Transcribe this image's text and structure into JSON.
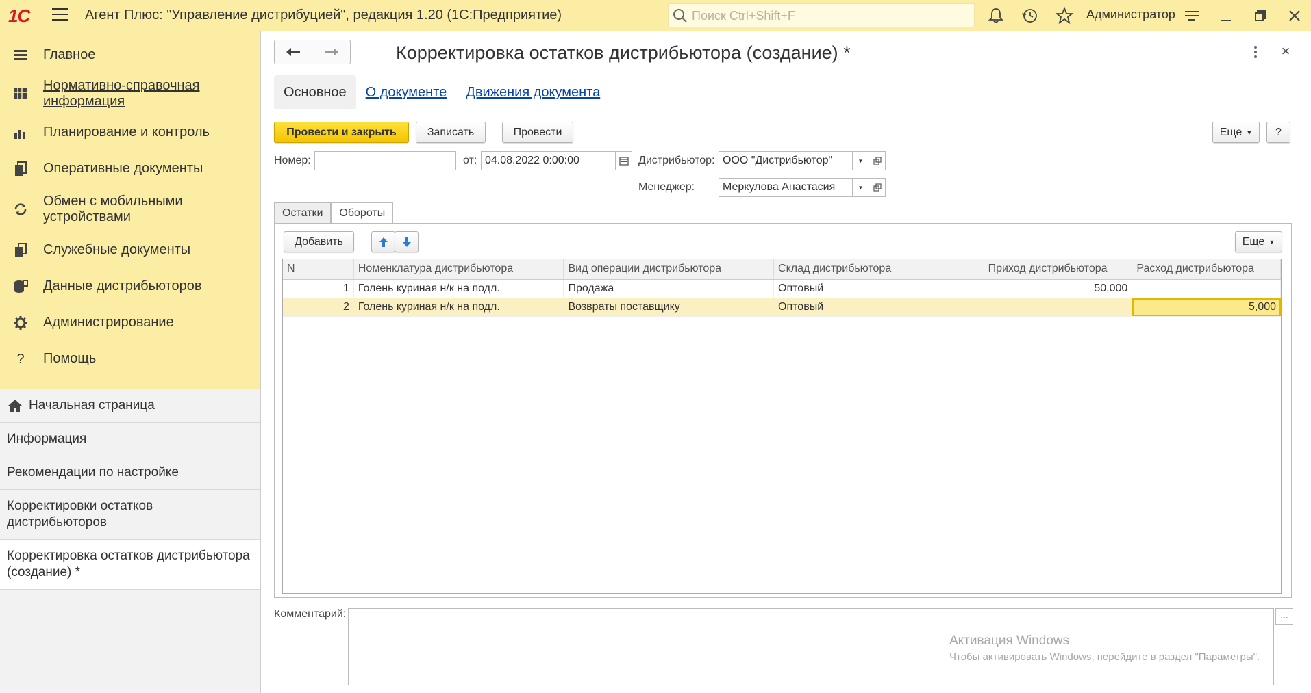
{
  "titlebar": {
    "logo": "1С",
    "app_title": "Агент Плюс: \"Управление дистрибуцией\", редакция 1.20  (1С:Предприятие)",
    "search_placeholder": "Поиск Ctrl+Shift+F",
    "user": "Администратор"
  },
  "sidebar": {
    "sections": [
      {
        "label": "Главное",
        "icon": "menu-lines-icon"
      },
      {
        "label": "Нормативно-справочная информация",
        "icon": "catalog-icon"
      },
      {
        "label": "Планирование и контроль",
        "icon": "bar-chart-icon"
      },
      {
        "label": "Оперативные документы",
        "icon": "documents-icon"
      },
      {
        "label": "Обмен с мобильными устройствами",
        "icon": "sync-icon"
      },
      {
        "label": "Служебные документы",
        "icon": "service-docs-icon"
      },
      {
        "label": "Данные дистрибьюторов",
        "icon": "database-icon"
      },
      {
        "label": "Администрирование",
        "icon": "gear-icon"
      },
      {
        "label": "Помощь",
        "icon": "question-icon"
      }
    ],
    "open_windows": [
      "Начальная страница",
      "Информация",
      "Рекомендации по настройке",
      "Корректировки остатков дистрибьюторов",
      "Корректировка остатков дистрибьютора (создание) *"
    ]
  },
  "form": {
    "title": "Корректировка остатков дистрибьютора (создание) *",
    "tabs": [
      "Основное",
      "О документе",
      "Движения документа"
    ],
    "buttons": {
      "post_close": "Провести и закрыть",
      "save": "Записать",
      "post": "Провести",
      "more": "Еще",
      "help": "?"
    },
    "fields": {
      "number_label": "Номер:",
      "number_value": "",
      "date_label": "от:",
      "date_value": "04.08.2022  0:00:00",
      "distributor_label": "Дистрибьютор:",
      "distributor_value": "ООО \"Дистрибьютор\"",
      "manager_label": "Менеджер:",
      "manager_value": "Меркулова Анастасия"
    },
    "inner_tabs": [
      "Остатки",
      "Обороты"
    ],
    "table_buttons": {
      "add": "Добавить",
      "more": "Еще"
    },
    "table": {
      "columns": [
        "N",
        "Номенклатура дистрибьютора",
        "Вид операции дистрибьютора",
        "Склад дистрибьютора",
        "Приход дистрибьютора",
        "Расход дистрибьютора"
      ],
      "rows": [
        {
          "n": "1",
          "item": "Голень куриная н/к на подл.",
          "operation": "Продажа",
          "warehouse": "Оптовый",
          "income": "50,000",
          "expense": ""
        },
        {
          "n": "2",
          "item": "Голень куриная н/к на подл.",
          "operation": "Возвраты поставщику",
          "warehouse": "Оптовый",
          "income": "",
          "expense": "5,000"
        }
      ]
    },
    "comment_label": "Комментарий:",
    "comment_button": "..."
  },
  "watermark": {
    "line1": "Активация Windows",
    "line2": "Чтобы активировать Windows, перейдите в раздел \"Параметры\"."
  }
}
